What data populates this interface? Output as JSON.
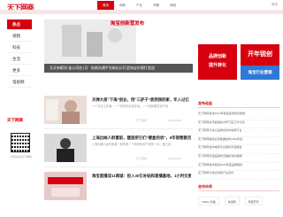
{
  "header": {
    "logo": "天下网商",
    "nav": [
      "首页",
      "网商",
      "产业",
      "专题",
      "网络"
    ],
    "login": "登录"
  },
  "sidebar": {
    "items": [
      "热点",
      "视频",
      "科技",
      "生活",
      "更多",
      "电视频"
    ],
    "brand": "天下网商",
    "qr_caption": "扫码关注天下网商"
  },
  "hero": {
    "side_text": "淘宝创新营发布",
    "caption": "天天有影问 该公司在1月 · 电商沟通平台新出示打造淘宝价格打造战"
  },
  "feed": [
    {
      "title": "天弹大叔“下海”创业，用“三驴子”卖到我的家，年入过亿",
      "summary": "一个文化工作者，一个电商的大叔天地，一个电商服务到千家",
      "tag": "天下网商",
      "date": "2020/08/19"
    },
    {
      "title": "上海出纳人财富前，建造把它们“硬盒的状”，6年销售额百亿",
      "summary": "上海沟通人运作着某一回事某一个电商有到千家的一天，做工具",
      "tag": "天下网商",
      "date": "2020/08/19"
    },
    {
      "title": "淘宝直播双11商城：投入30亿补贴和直播基地，1小时交易",
      "summary": "",
      "tag": "",
      "date": ""
    }
  ],
  "ads": {
    "ad1_line1": "品牌创新",
    "ad1_line2": "提升转化",
    "ad2_text": "开年锐创",
    "ad3_text": "淘宝行业营销"
  },
  "right": {
    "news_header": "发布动态",
    "news": [
      "天下网商发布2020年淘宝卖家成长报告",
      "天下网商资讯直播的大号门店工作计划",
      "天下网商与本土品牌合作的电商平台",
      "天下网商跨境业务数据发布2020年度",
      "天下网商发布电商平台销售年度报告",
      "天下网商优选品牌的天猫新零售数据",
      "天下网商发布淘宝2020年度品牌报告",
      "天下网商与地方特色产业合作"
    ],
    "partners_header": "合作伙伴",
    "partners": [
      "TMALL天猫",
      "淘宝网",
      "阿里巴巴",
      "菜鸟"
    ]
  },
  "colors": {
    "brand_red": "#d6000f",
    "accent_blue": "#2f78d8"
  }
}
